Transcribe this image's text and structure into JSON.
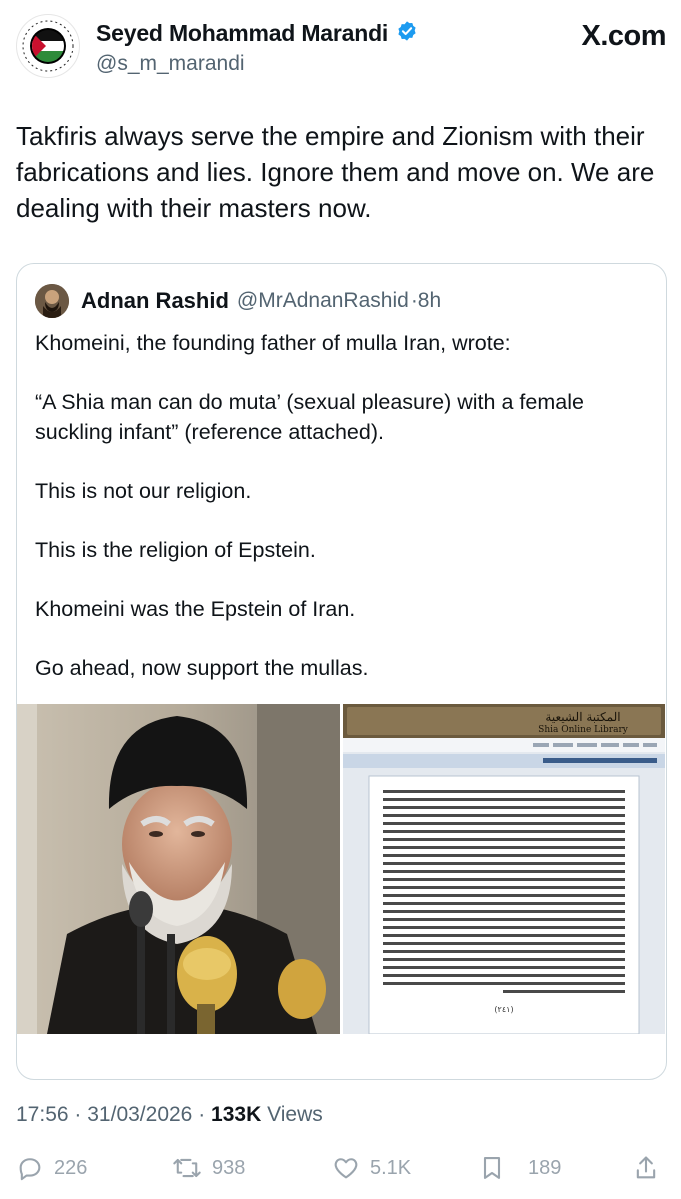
{
  "author": {
    "name": "Seyed Mohammad Marandi",
    "handle": "@s_m_marandi",
    "verified": true
  },
  "brand": {
    "prefix": "X",
    "suffix": ".com"
  },
  "tweet": {
    "text": "Takfiris always serve the empire and Zionism with their fabrications and lies. Ignore them and move on. We are dealing with their masters now."
  },
  "quote": {
    "name": "Adnan Rashid",
    "handle": "@MrAdnanRashid",
    "time": "·8h",
    "paragraphs": [
      "Khomeini, the founding father of mulla Iran, wrote:",
      "“A Shia man can do muta’ (sexual pleasure) with a female suckling infant” (reference attached).",
      "This is not our religion.",
      "This is the religion of Epstein.",
      "Khomeini was the Epstein of Iran.",
      "Go ahead, now support the mullas."
    ],
    "doc": {
      "library_ar": "المكتبة الشيعية",
      "library_en": "Shia Online Library",
      "page_number": "(٢٤١)"
    }
  },
  "meta": {
    "time": "17:56",
    "date": "31/03/2026",
    "views_count": "133K",
    "views_label": "Views"
  },
  "actions": {
    "replies": "226",
    "reposts": "938",
    "likes": "5.1K",
    "bookmarks": "189"
  },
  "colors": {
    "text": "#0f1419",
    "secondary": "#536471",
    "verified": "#1d9bf0",
    "border": "#cfd9de",
    "action": "#9aa4ad"
  }
}
